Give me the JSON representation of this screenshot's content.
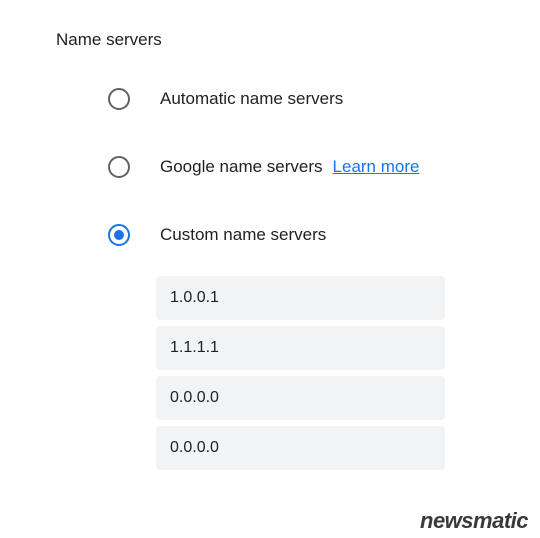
{
  "section": {
    "title": "Name servers"
  },
  "options": {
    "automatic": {
      "label": "Automatic name servers",
      "selected": false
    },
    "google": {
      "label": "Google name servers",
      "learnMore": "Learn more",
      "selected": false
    },
    "custom": {
      "label": "Custom name servers",
      "selected": true
    }
  },
  "customServers": {
    "ns1": "1.0.0.1",
    "ns2": "1.1.1.1",
    "ns3": "0.0.0.0",
    "ns4": "0.0.0.0"
  },
  "watermark": "newsmatic"
}
